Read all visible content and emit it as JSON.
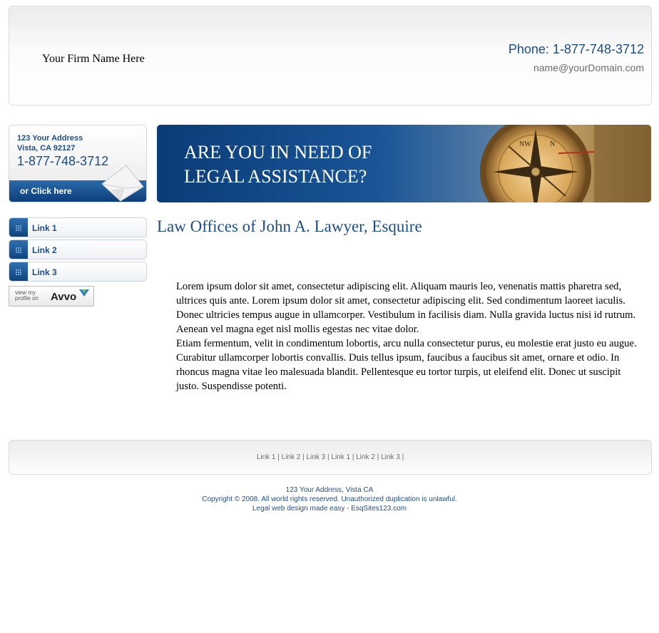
{
  "header": {
    "firm_name": "Your Firm Name Here",
    "phone": "Phone: 1-877-748-3712",
    "email": "name@yourDomain.com"
  },
  "contact": {
    "address_line1": "123 Your Address",
    "address_line2": "Vista, CA 92127",
    "phone": "1-877-748-3712",
    "cta": "or Click here"
  },
  "banner": {
    "line1": "ARE YOU IN NEED OF",
    "line2": "LEGAL ASSISTANCE?"
  },
  "nav": {
    "items": [
      {
        "label": "Link 1"
      },
      {
        "label": "Link 2"
      },
      {
        "label": "Link 3"
      }
    ],
    "avvo": {
      "small_text": "view my profile on",
      "logo": "Avvo"
    }
  },
  "main": {
    "title": "Law Offices of John A. Lawyer, Esquire",
    "paragraph1": "Lorem ipsum dolor sit amet, consectetur adipiscing elit. Aliquam mauris leo, venenatis mattis pharetra sed, ultrices quis ante. Lorem ipsum dolor sit amet, consectetur adipiscing elit. Sed condimentum laoreet iaculis. Donec ultricies tempus augue in ullamcorper. Vestibulum in facilisis diam. Nulla gravida luctus nisi id rutrum. Aenean vel magna eget nisl mollis egestas nec vitae dolor.",
    "paragraph2": "Etiam fermentum, velit in condimentum lobortis, arcu nulla consectetur purus, eu molestie erat justo eu augue. Curabitur ullamcorper lobortis convallis. Duis tellus ipsum, faucibus a faucibus sit amet, ornare et odio. In rhoncus magna vitae leo malesuada blandit. Pellentesque eu tortor turpis, ut eleifend elit. Donec ut suscipit justo. Suspendisse potenti."
  },
  "footer": {
    "links": [
      "Link 1",
      "Link 2",
      "Link 3",
      "Link 1",
      "Link 2",
      "Link 3"
    ],
    "separator": "|",
    "address": "123 Your Address, Vista CA",
    "copyright": "Copyright © 2008. All world rights reserved. Unauthorized duplication is unlawful.",
    "credit": "Legal web design made easy - EsqSites123.com"
  },
  "colors": {
    "brand_blue": "#1a4d86",
    "button_blue": "#0f447f"
  },
  "icons": {
    "envelope": "envelope-icon",
    "compass": "compass-icon",
    "nav_bullet": "dots-icon"
  }
}
